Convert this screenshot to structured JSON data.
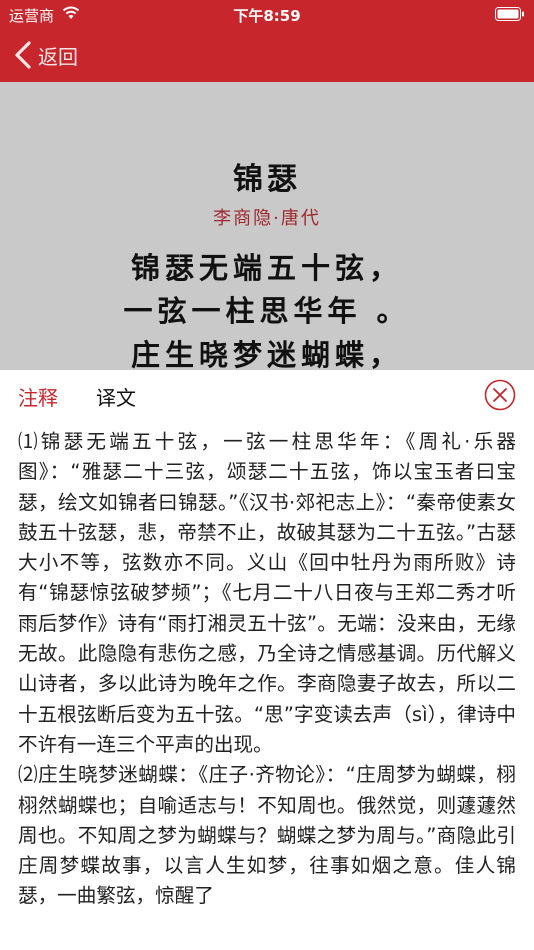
{
  "status_bar": {
    "carrier": "运营商",
    "time": "下午8:59",
    "wifi_icon": "wifi-icon",
    "battery_icon": "battery-icon"
  },
  "nav": {
    "back_label": "返回",
    "back_icon": "chevron-left-icon"
  },
  "poem": {
    "title": "锦瑟",
    "author": "李商隐·唐代",
    "lines": [
      "锦瑟无端五十弦，",
      "一弦一柱思华年 。",
      "庄生晓梦迷蝴蝶，"
    ]
  },
  "tabs": [
    {
      "label": "注释",
      "active": true
    },
    {
      "label": "译文",
      "active": false
    }
  ],
  "close_icon": "close-circle-icon",
  "notes": [
    "⑴锦瑟无端五十弦，一弦一柱思华年：《周礼·乐器图》：“雅瑟二十三弦，颂瑟二十五弦，饰以宝玉者曰宝瑟，绘文如锦者曰锦瑟。”《汉书·郊祀志上》：“秦帝使素女鼓五十弦瑟，悲，帝禁不止，故破其瑟为二十五弦。”古瑟大小不等，弦数亦不同。义山《回中牡丹为雨所败》诗有“锦瑟惊弦破梦频”；《七月二十八日夜与王郑二秀才听雨后梦作》诗有“雨打湘灵五十弦”。无端：没来由，无缘无故。此隐隐有悲伤之感，乃全诗之情感基调。历代解义山诗者，多以此诗为晚年之作。李商隐妻子故去，所以二十五根弦断后变为五十弦。“思”字变读去声（sì），律诗中不许有一连三个平声的出现。",
    "⑵庄生晓梦迷蝴蝶：《庄子·齐物论》：“庄周梦为蝴蝶，栩栩然蝴蝶也；自喻适志与！不知周也。俄然觉，则蘧蘧然周也。不知周之梦为蝴蝶与？蝴蝶之梦为周与。”商隐此引庄周梦蝶故事，以言人生如梦，往事如烟之意。佳人锦瑟，一曲繁弦，惊醒了"
  ]
}
